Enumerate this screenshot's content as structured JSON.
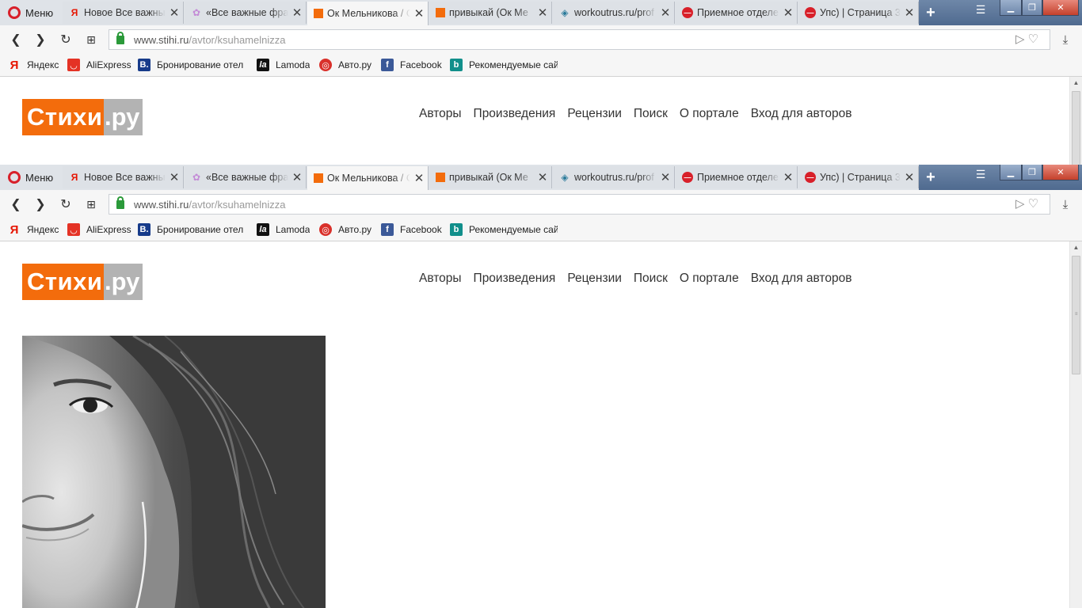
{
  "browser": {
    "menu_label": "Меню",
    "tabs": [
      {
        "title": "Новое Все важные",
        "favicon": "yandex-icon",
        "active": false
      },
      {
        "title": "«Все важные фраз",
        "favicon": "flower-icon",
        "active": false
      },
      {
        "title": "Ок Мельникова / С",
        "favicon": "stihi-icon",
        "active": true
      },
      {
        "title": "привыкай (Ок Ме",
        "favicon": "stihi-icon",
        "active": false
      },
      {
        "title": "workoutrus.ru/prof",
        "favicon": "workout-icon",
        "active": false
      },
      {
        "title": "Приемное отделе",
        "favicon": "blocked-icon",
        "active": false
      },
      {
        "title": "Упс) | Страница 3",
        "favicon": "blocked-icon",
        "active": false
      }
    ],
    "url_host": "www.stihi.ru",
    "url_path": "/avtor/ksuhamelnizza",
    "bookmarks": [
      {
        "label": "Яндекс",
        "icon": "yandex-icon",
        "color": "#e61400"
      },
      {
        "label": "AliExpress",
        "icon": "aliexpress-icon",
        "color": "#e43225"
      },
      {
        "label": "Бронирование отел",
        "icon": "booking-icon",
        "color": "#173b8a"
      },
      {
        "label": "Lamoda",
        "icon": "lamoda-icon",
        "color": "#111111"
      },
      {
        "label": "Авто.ру",
        "icon": "autoru-icon",
        "color": "#d9302a"
      },
      {
        "label": "Facebook",
        "icon": "facebook-icon",
        "color": "#3b5998"
      },
      {
        "label": "Рекомендуемые сай",
        "icon": "bing-icon",
        "color": "#118f8b"
      }
    ]
  },
  "site": {
    "logo_left": "Стихи",
    "logo_right": ".ру",
    "nav": [
      "Авторы",
      "Произведения",
      "Рецензии",
      "Поиск",
      "О портале",
      "Вход для авторов"
    ]
  },
  "colors": {
    "accent": "#f36c0c",
    "logo_gray": "#b3b3b3",
    "tabstrip_dark": "#4f6a8f"
  }
}
